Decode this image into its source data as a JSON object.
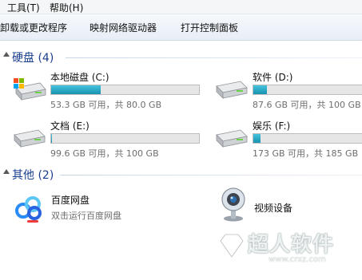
{
  "menubar": {
    "tools": "工具(T)",
    "help": "帮助(H)"
  },
  "toolbar": {
    "uninstall": "卸载或更改程序",
    "map_drive": "映射网络驱动器",
    "control_panel": "打开控制面板"
  },
  "groups": {
    "hdd": {
      "title": "硬盘 (4)"
    },
    "other": {
      "title": "其他 (2)"
    }
  },
  "drives": [
    {
      "name": "本地磁盘 (C:)",
      "free_text": "53.3 GB 可用，共 80.0 GB",
      "used_fraction": 0.334
    },
    {
      "name": "软件 (D:)",
      "free_text": "87.6 GB 可用，共 100 GB",
      "used_fraction": 0.124
    },
    {
      "name": "文档 (E:)",
      "free_text": "99.6 GB 可用，共 100 GB",
      "used_fraction": 0.004
    },
    {
      "name": "娱乐 (F:)",
      "free_text": "173 GB 可用，共 185 GB",
      "used_fraction": 0.065
    }
  ],
  "others": [
    {
      "name": "百度网盘",
      "sub": "双击运行百度网盘"
    },
    {
      "name": "视频设备",
      "sub": ""
    }
  ],
  "watermark": {
    "text": "超人软件",
    "url": "www.crxz.com"
  },
  "colors": {
    "group_title": "#1a3e8e",
    "bar_fill": "#1792b0"
  }
}
